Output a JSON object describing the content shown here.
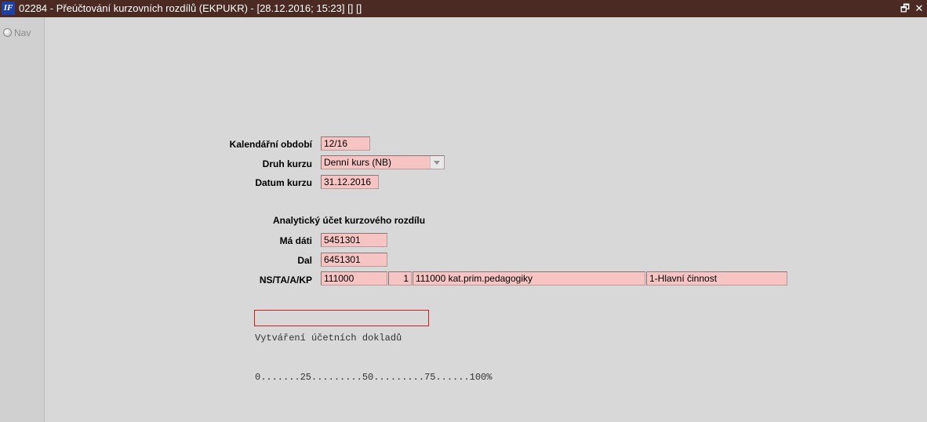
{
  "titlebar": {
    "icon_text": "IF",
    "title": "02284 - Přeúčtování kurzovních rozdílů (EKPUKR) - [28.12.2016; 15:23]  [] []",
    "restore_glyph": "🗗",
    "close_glyph": "✕"
  },
  "sidebar": {
    "nav_label": "Nav"
  },
  "form": {
    "period_label": "Kalendářní období",
    "period_value": "12/16",
    "rate_type_label": "Druh kurzu",
    "rate_type_value": "Denní kurs (NB)",
    "rate_date_label": "Datum kurzu",
    "rate_date_value": "31.12.2016"
  },
  "analytic": {
    "heading": "Analytický účet kurzového rozdílu",
    "debit_label": "Má dáti",
    "debit_value": "5451301",
    "credit_label": "Dal",
    "credit_value": "6451301",
    "ns_label": "NS/TA/A/KP",
    "ns_value": "111000",
    "ta_value": "1",
    "a_value": "111000 kat.prim.pedagogiky",
    "kp_value": "1-Hlavní činnost"
  },
  "progress": {
    "fraction": 0,
    "caption": "Vytváření účetních dokladů",
    "scale": "0.......25.........50.........75......100%"
  },
  "colors": {
    "titlebar_bg": "#4a2a22",
    "field_bg": "#f7c4c4",
    "progress_border": "#d02020"
  }
}
